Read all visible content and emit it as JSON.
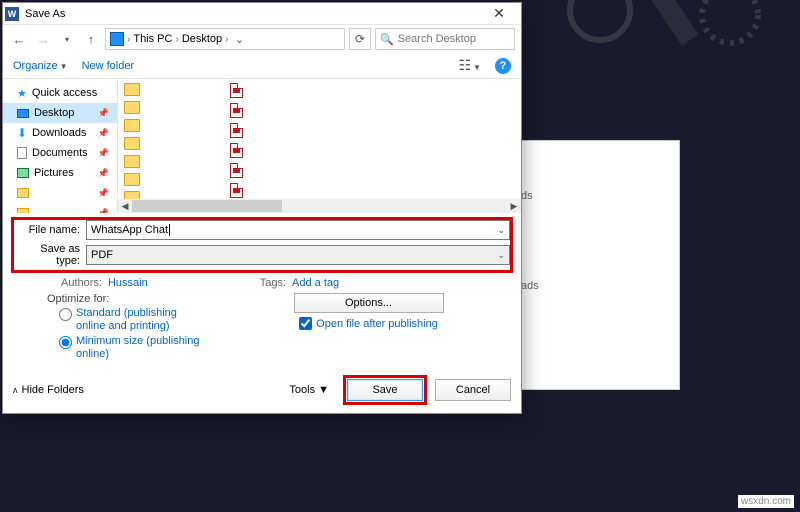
{
  "titlebar": {
    "title": "Save As",
    "close": "✕"
  },
  "nav": {
    "breadcrumb": [
      "This PC",
      "Desktop"
    ],
    "search_placeholder": "Search Desktop"
  },
  "toolbar": {
    "organize": "Organize",
    "new_folder": "New folder"
  },
  "sidebar": {
    "items": [
      {
        "label": "Quick access",
        "icon": "star"
      },
      {
        "label": "Desktop",
        "icon": "desk",
        "selected": true,
        "pinned": true
      },
      {
        "label": "Downloads",
        "icon": "down",
        "pinned": true
      },
      {
        "label": "Documents",
        "icon": "doc",
        "pinned": true
      },
      {
        "label": "Pictures",
        "icon": "pic",
        "pinned": true
      },
      {
        "label": "",
        "icon": "fold",
        "pinned": true
      },
      {
        "label": "",
        "icon": "fold",
        "pinned": true
      },
      {
        "label": "",
        "icon": "fold",
        "pinned": true
      }
    ]
  },
  "fields": {
    "file_name_label": "File name:",
    "file_name_value": "WhatsApp Chat ",
    "save_type_label": "Save as type:",
    "save_type_value": "PDF"
  },
  "meta": {
    "authors_label": "Authors:",
    "authors_value": "Hussain",
    "tags_label": "Tags:",
    "tags_value": "Add a tag"
  },
  "optimize": {
    "label": "Optimize for:",
    "standard": "Standard (publishing online and printing)",
    "minimum": "Minimum size (publishing online)",
    "options_btn": "Options...",
    "open_after": "Open file after publishing"
  },
  "footer": {
    "hide_folders": "Hide Folders",
    "tools": "Tools",
    "save": "Save",
    "cancel": "Cancel"
  },
  "rear": {
    "line1": "ds",
    "line2": "ads"
  },
  "watermark": "wsxdn.com"
}
